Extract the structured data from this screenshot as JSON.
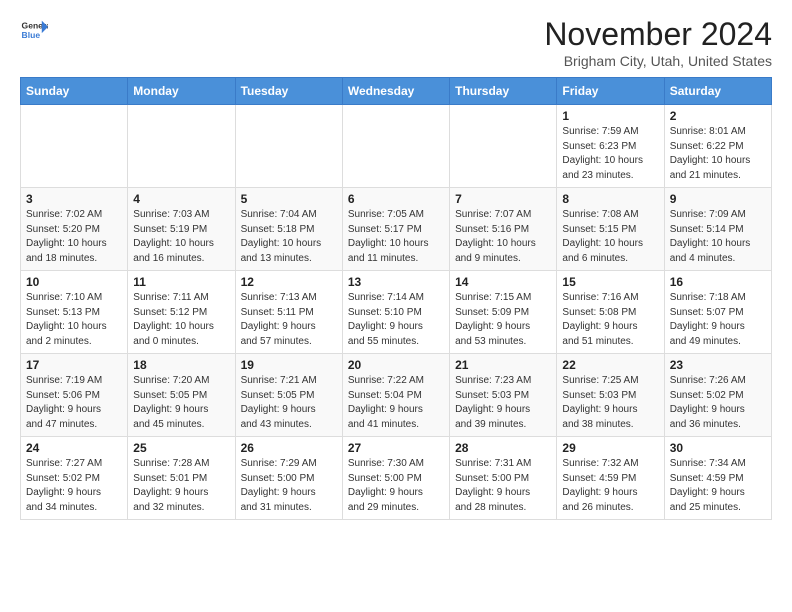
{
  "logo": {
    "text_general": "General",
    "text_blue": "Blue"
  },
  "header": {
    "month_title": "November 2024",
    "location": "Brigham City, Utah, United States"
  },
  "weekdays": [
    "Sunday",
    "Monday",
    "Tuesday",
    "Wednesday",
    "Thursday",
    "Friday",
    "Saturday"
  ],
  "weeks": [
    [
      {
        "day": "",
        "info": ""
      },
      {
        "day": "",
        "info": ""
      },
      {
        "day": "",
        "info": ""
      },
      {
        "day": "",
        "info": ""
      },
      {
        "day": "",
        "info": ""
      },
      {
        "day": "1",
        "info": "Sunrise: 7:59 AM\nSunset: 6:23 PM\nDaylight: 10 hours\nand 23 minutes."
      },
      {
        "day": "2",
        "info": "Sunrise: 8:01 AM\nSunset: 6:22 PM\nDaylight: 10 hours\nand 21 minutes."
      }
    ],
    [
      {
        "day": "3",
        "info": "Sunrise: 7:02 AM\nSunset: 5:20 PM\nDaylight: 10 hours\nand 18 minutes."
      },
      {
        "day": "4",
        "info": "Sunrise: 7:03 AM\nSunset: 5:19 PM\nDaylight: 10 hours\nand 16 minutes."
      },
      {
        "day": "5",
        "info": "Sunrise: 7:04 AM\nSunset: 5:18 PM\nDaylight: 10 hours\nand 13 minutes."
      },
      {
        "day": "6",
        "info": "Sunrise: 7:05 AM\nSunset: 5:17 PM\nDaylight: 10 hours\nand 11 minutes."
      },
      {
        "day": "7",
        "info": "Sunrise: 7:07 AM\nSunset: 5:16 PM\nDaylight: 10 hours\nand 9 minutes."
      },
      {
        "day": "8",
        "info": "Sunrise: 7:08 AM\nSunset: 5:15 PM\nDaylight: 10 hours\nand 6 minutes."
      },
      {
        "day": "9",
        "info": "Sunrise: 7:09 AM\nSunset: 5:14 PM\nDaylight: 10 hours\nand 4 minutes."
      }
    ],
    [
      {
        "day": "10",
        "info": "Sunrise: 7:10 AM\nSunset: 5:13 PM\nDaylight: 10 hours\nand 2 minutes."
      },
      {
        "day": "11",
        "info": "Sunrise: 7:11 AM\nSunset: 5:12 PM\nDaylight: 10 hours\nand 0 minutes."
      },
      {
        "day": "12",
        "info": "Sunrise: 7:13 AM\nSunset: 5:11 PM\nDaylight: 9 hours\nand 57 minutes."
      },
      {
        "day": "13",
        "info": "Sunrise: 7:14 AM\nSunset: 5:10 PM\nDaylight: 9 hours\nand 55 minutes."
      },
      {
        "day": "14",
        "info": "Sunrise: 7:15 AM\nSunset: 5:09 PM\nDaylight: 9 hours\nand 53 minutes."
      },
      {
        "day": "15",
        "info": "Sunrise: 7:16 AM\nSunset: 5:08 PM\nDaylight: 9 hours\nand 51 minutes."
      },
      {
        "day": "16",
        "info": "Sunrise: 7:18 AM\nSunset: 5:07 PM\nDaylight: 9 hours\nand 49 minutes."
      }
    ],
    [
      {
        "day": "17",
        "info": "Sunrise: 7:19 AM\nSunset: 5:06 PM\nDaylight: 9 hours\nand 47 minutes."
      },
      {
        "day": "18",
        "info": "Sunrise: 7:20 AM\nSunset: 5:05 PM\nDaylight: 9 hours\nand 45 minutes."
      },
      {
        "day": "19",
        "info": "Sunrise: 7:21 AM\nSunset: 5:05 PM\nDaylight: 9 hours\nand 43 minutes."
      },
      {
        "day": "20",
        "info": "Sunrise: 7:22 AM\nSunset: 5:04 PM\nDaylight: 9 hours\nand 41 minutes."
      },
      {
        "day": "21",
        "info": "Sunrise: 7:23 AM\nSunset: 5:03 PM\nDaylight: 9 hours\nand 39 minutes."
      },
      {
        "day": "22",
        "info": "Sunrise: 7:25 AM\nSunset: 5:03 PM\nDaylight: 9 hours\nand 38 minutes."
      },
      {
        "day": "23",
        "info": "Sunrise: 7:26 AM\nSunset: 5:02 PM\nDaylight: 9 hours\nand 36 minutes."
      }
    ],
    [
      {
        "day": "24",
        "info": "Sunrise: 7:27 AM\nSunset: 5:02 PM\nDaylight: 9 hours\nand 34 minutes."
      },
      {
        "day": "25",
        "info": "Sunrise: 7:28 AM\nSunset: 5:01 PM\nDaylight: 9 hours\nand 32 minutes."
      },
      {
        "day": "26",
        "info": "Sunrise: 7:29 AM\nSunset: 5:00 PM\nDaylight: 9 hours\nand 31 minutes."
      },
      {
        "day": "27",
        "info": "Sunrise: 7:30 AM\nSunset: 5:00 PM\nDaylight: 9 hours\nand 29 minutes."
      },
      {
        "day": "28",
        "info": "Sunrise: 7:31 AM\nSunset: 5:00 PM\nDaylight: 9 hours\nand 28 minutes."
      },
      {
        "day": "29",
        "info": "Sunrise: 7:32 AM\nSunset: 4:59 PM\nDaylight: 9 hours\nand 26 minutes."
      },
      {
        "day": "30",
        "info": "Sunrise: 7:34 AM\nSunset: 4:59 PM\nDaylight: 9 hours\nand 25 minutes."
      }
    ]
  ]
}
